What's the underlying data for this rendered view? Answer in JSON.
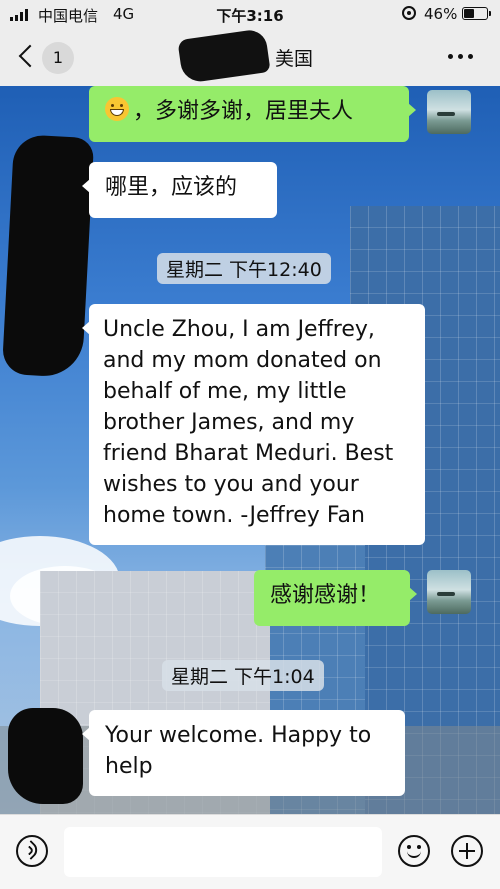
{
  "status_bar": {
    "carrier": "中国电信",
    "network": "4G",
    "time": "下午3:16",
    "battery": "46%",
    "battery_level": 0.46
  },
  "header": {
    "unread_count": "1",
    "title": "美国"
  },
  "messages": [
    {
      "side": "out",
      "emoji": "smile-emoji",
      "text": "，多谢多谢，居里夫人"
    },
    {
      "side": "in",
      "text": "哪里，应该的"
    },
    {
      "type": "timestamp",
      "text": "星期二 下午12:40"
    },
    {
      "side": "in",
      "text": "Uncle Zhou, I am Jeffrey, and my mom donated on behalf of me, my little brother James, and my friend Bharat Meduri. Best wishes to you and your home town. -Jeffrey Fan"
    },
    {
      "side": "out",
      "text": "感谢感谢！"
    },
    {
      "type": "timestamp",
      "text": "星期二 下午1:04"
    },
    {
      "side": "in",
      "text": "Your welcome. Happy to help"
    }
  ],
  "input_bar": {
    "placeholder": "",
    "icons": [
      "voice-icon",
      "emoji-icon",
      "plus-icon"
    ]
  }
}
